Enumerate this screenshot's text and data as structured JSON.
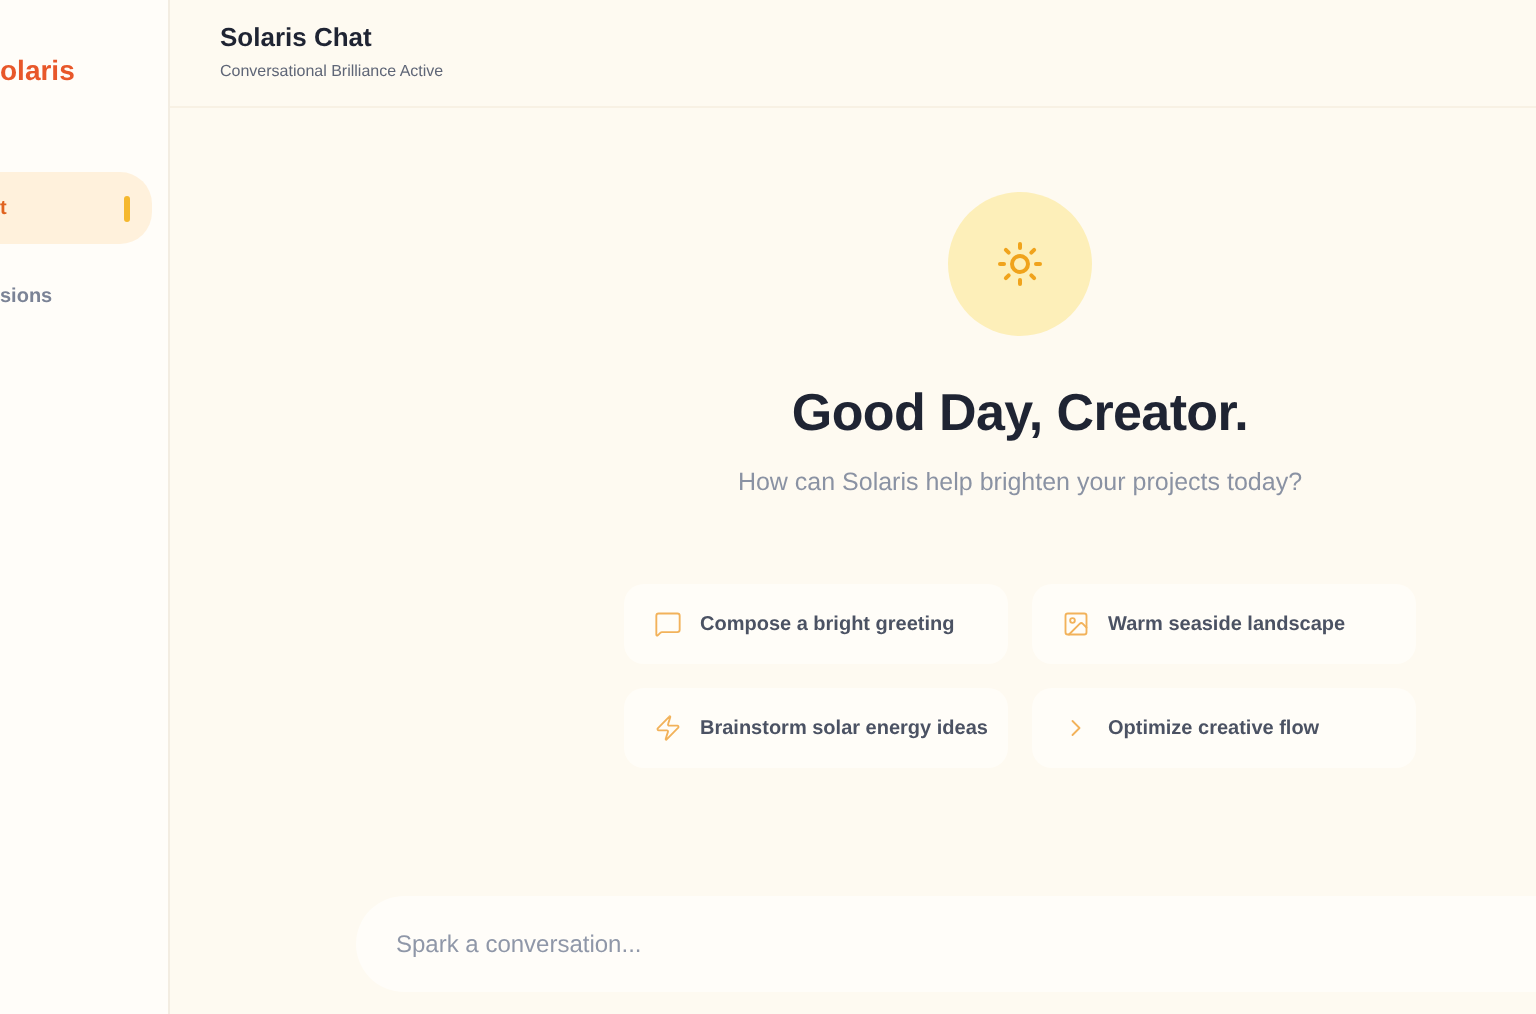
{
  "sidebar": {
    "logo": "olaris",
    "items": [
      {
        "label": "t",
        "selected": true
      },
      {
        "label": "sions",
        "selected": false
      }
    ]
  },
  "header": {
    "title": "Solaris Chat",
    "subtitle": "Conversational Brilliance Active"
  },
  "hero": {
    "title": "Good Day, Creator.",
    "subtitle": "How can Solaris help brighten your projects today?"
  },
  "suggestions": [
    {
      "kind": "chat",
      "label": "Compose a bright greeting"
    },
    {
      "kind": "image",
      "label": "Warm seaside landscape"
    },
    {
      "kind": "bolt",
      "label": "Brainstorm solar energy ideas"
    },
    {
      "kind": "arrow",
      "label": "Optimize creative flow"
    }
  ],
  "composer": {
    "placeholder": "Spark a conversation..."
  }
}
